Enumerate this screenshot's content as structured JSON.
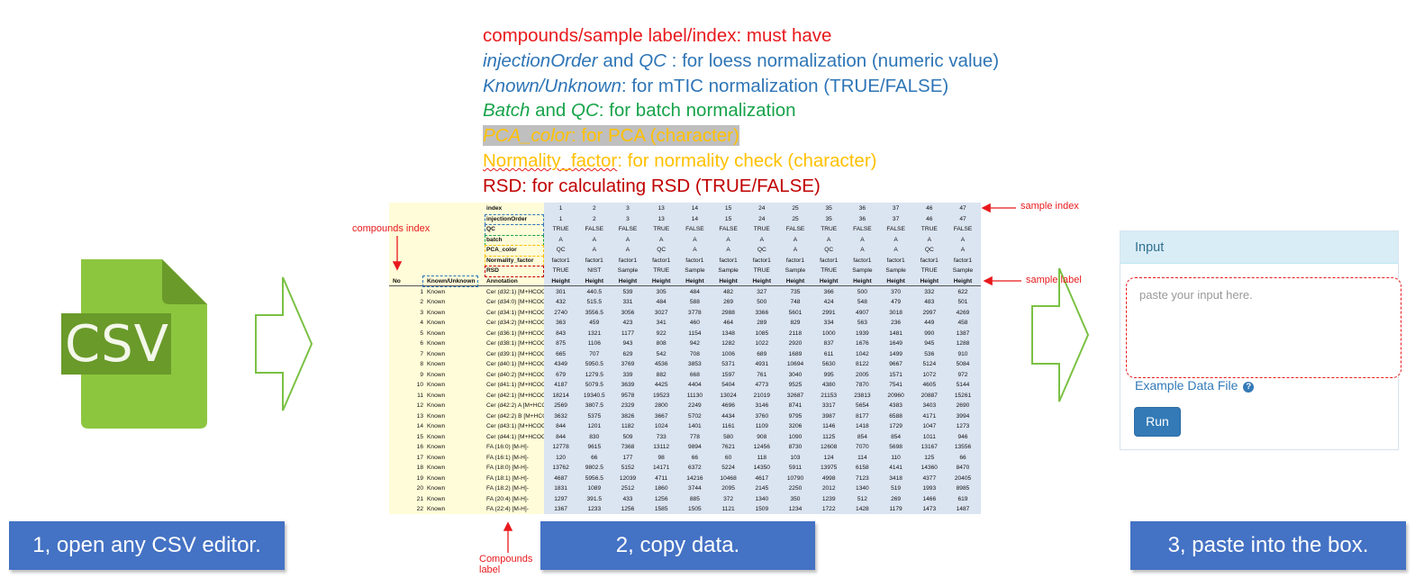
{
  "csv_icon": {
    "label": "CSV",
    "color_main": "#8cc63f",
    "color_fold": "#6a9a2a"
  },
  "legend": {
    "line1": "compounds/sample label/index: must have",
    "line2_a": "injectionOrder",
    "line2_b": " and ",
    "line2_c": "QC",
    "line2_d": " : for loess normalization (numeric value)",
    "line3_a": "Known/Unknown",
    "line3_b": ": for mTIC normalization (TRUE/FALSE)",
    "line4_a": "Batch",
    "line4_b": " and ",
    "line4_c": "QC",
    "line4_d": ": for batch normalization",
    "line5_a": "PCA_color",
    "line5_b": ": for PCA (character)",
    "line6_a": "Normality_factor",
    "line6_b": ": for normality check (character)",
    "line7": "RSD: for calculating RSD (TRUE/FALSE)"
  },
  "spreadsheet": {
    "meta_rows": [
      {
        "label": "index",
        "values": [
          "1",
          "2",
          "3",
          "13",
          "14",
          "15",
          "24",
          "25",
          "35",
          "36",
          "37",
          "46",
          "47"
        ]
      },
      {
        "label": "injectionOrder",
        "values": [
          "1",
          "2",
          "3",
          "13",
          "14",
          "15",
          "24",
          "25",
          "35",
          "36",
          "37",
          "46",
          "47"
        ]
      },
      {
        "label": "QC",
        "values": [
          "TRUE",
          "FALSE",
          "FALSE",
          "TRUE",
          "FALSE",
          "FALSE",
          "TRUE",
          "FALSE",
          "TRUE",
          "FALSE",
          "FALSE",
          "TRUE",
          "FALSE"
        ]
      },
      {
        "label": "batch",
        "values": [
          "A",
          "A",
          "A",
          "A",
          "A",
          "A",
          "A",
          "A",
          "A",
          "A",
          "A",
          "A",
          "A"
        ]
      },
      {
        "label": "PCA_color",
        "values": [
          "QC",
          "A",
          "A",
          "QC",
          "A",
          "A",
          "QC",
          "A",
          "QC",
          "A",
          "A",
          "QC",
          "A"
        ]
      },
      {
        "label": "Normality_factor",
        "values": [
          "factor1",
          "factor1",
          "factor1",
          "factor1",
          "factor1",
          "factor1",
          "factor1",
          "factor1",
          "factor1",
          "factor1",
          "factor1",
          "factor1",
          "factor1"
        ]
      },
      {
        "label": "RSD",
        "values": [
          "TRUE",
          "NIST",
          "Sample",
          "TRUE",
          "Sample",
          "Sample",
          "TRUE",
          "Sample",
          "TRUE",
          "Sample",
          "Sample",
          "TRUE",
          "Sample"
        ]
      }
    ],
    "header": {
      "no": "No",
      "known": "Known/Unknown",
      "annotation": "Annotation",
      "value_header": "Height"
    },
    "rows": [
      {
        "no": "1",
        "known": "Known",
        "annotation": "Cer (d32:1) [M+HCOO",
        "values": [
          "301",
          "440.5",
          "539",
          "305",
          "484",
          "482",
          "327",
          "735",
          "366",
          "500",
          "370",
          "332",
          "622"
        ]
      },
      {
        "no": "2",
        "known": "Known",
        "annotation": "Cer (d34:0) [M+HCOO",
        "values": [
          "432",
          "515.5",
          "331",
          "484",
          "588",
          "269",
          "500",
          "748",
          "424",
          "548",
          "479",
          "483",
          "501"
        ]
      },
      {
        "no": "3",
        "known": "Known",
        "annotation": "Cer (d34:1) [M+HCOO",
        "values": [
          "2740",
          "3556.5",
          "3056",
          "3027",
          "3778",
          "2988",
          "3366",
          "5601",
          "2991",
          "4907",
          "3018",
          "2997",
          "4269"
        ]
      },
      {
        "no": "4",
        "known": "Known",
        "annotation": "Cer (d34:2) [M+HCOO",
        "values": [
          "363",
          "459",
          "423",
          "341",
          "460",
          "464",
          "289",
          "829",
          "334",
          "563",
          "236",
          "449",
          "458"
        ]
      },
      {
        "no": "5",
        "known": "Known",
        "annotation": "Cer (d36:1) [M+HCOO",
        "values": [
          "843",
          "1321",
          "1177",
          "922",
          "1154",
          "1348",
          "1085",
          "2118",
          "1000",
          "1939",
          "1481",
          "990",
          "1387"
        ]
      },
      {
        "no": "6",
        "known": "Known",
        "annotation": "Cer (d38:1) [M+HCOO",
        "values": [
          "875",
          "1106",
          "943",
          "808",
          "942",
          "1282",
          "1022",
          "2920",
          "837",
          "1676",
          "1649",
          "945",
          "1288"
        ]
      },
      {
        "no": "7",
        "known": "Known",
        "annotation": "Cer (d39:1) [M+HCOO",
        "values": [
          "665",
          "707",
          "629",
          "542",
          "708",
          "1006",
          "689",
          "1689",
          "611",
          "1042",
          "1499",
          "536",
          "910"
        ]
      },
      {
        "no": "8",
        "known": "Known",
        "annotation": "Cer (d40:1) [M+HCOO",
        "values": [
          "4349",
          "5950.5",
          "3769",
          "4536",
          "3853",
          "5371",
          "4931",
          "10694",
          "5630",
          "8122",
          "9667",
          "5124",
          "5084"
        ]
      },
      {
        "no": "9",
        "known": "Known",
        "annotation": "Cer (d40:2) [M+HCOO",
        "values": [
          "679",
          "1279.5",
          "339",
          "882",
          "668",
          "1597",
          "761",
          "3040",
          "995",
          "2005",
          "1571",
          "1072",
          "972"
        ]
      },
      {
        "no": "10",
        "known": "Known",
        "annotation": "Cer (d41:1) [M+HCOO",
        "values": [
          "4187",
          "5079.5",
          "3639",
          "4425",
          "4404",
          "5404",
          "4773",
          "9525",
          "4380",
          "7870",
          "7541",
          "4605",
          "5144"
        ]
      },
      {
        "no": "11",
        "known": "Known",
        "annotation": "Cer (d42:1) [M+HCOO",
        "values": [
          "18214",
          "19340.5",
          "9578",
          "19523",
          "11130",
          "13024",
          "21019",
          "32687",
          "21153",
          "23813",
          "20960",
          "20887",
          "15261"
        ]
      },
      {
        "no": "12",
        "known": "Known",
        "annotation": "Cer (d42:2) A [M+HCO",
        "values": [
          "2569",
          "3807.5",
          "2329",
          "2800",
          "2249",
          "4696",
          "3146",
          "8741",
          "3317",
          "5654",
          "4383",
          "3403",
          "2690"
        ]
      },
      {
        "no": "13",
        "known": "Known",
        "annotation": "Cer (d42:2) B [M+HCO",
        "values": [
          "3632",
          "5375",
          "3826",
          "3667",
          "5702",
          "4434",
          "3760",
          "9795",
          "3987",
          "8177",
          "6588",
          "4171",
          "3994"
        ]
      },
      {
        "no": "14",
        "known": "Known",
        "annotation": "Cer (d43:1) [M+HCOO",
        "values": [
          "844",
          "1201",
          "1182",
          "1024",
          "1401",
          "1161",
          "1109",
          "3206",
          "1146",
          "1418",
          "1729",
          "1047",
          "1273"
        ]
      },
      {
        "no": "15",
        "known": "Known",
        "annotation": "Cer (d44:1) [M+HCOO",
        "values": [
          "844",
          "830",
          "509",
          "733",
          "778",
          "580",
          "908",
          "1090",
          "1125",
          "854",
          "854",
          "1011",
          "946"
        ]
      },
      {
        "no": "16",
        "known": "Known",
        "annotation": "FA (16:0) [M-H]-",
        "values": [
          "12778",
          "9615",
          "7368",
          "13112",
          "9894",
          "7621",
          "12456",
          "8730",
          "12608",
          "7070",
          "5698",
          "13167",
          "13556"
        ]
      },
      {
        "no": "17",
        "known": "Known",
        "annotation": "FA (16:1) [M-H]-",
        "values": [
          "120",
          "66",
          "177",
          "98",
          "66",
          "60",
          "118",
          "103",
          "124",
          "114",
          "110",
          "125",
          "66"
        ]
      },
      {
        "no": "18",
        "known": "Known",
        "annotation": "FA (18:0) [M-H]-",
        "values": [
          "13762",
          "9802.5",
          "5152",
          "14171",
          "6372",
          "5224",
          "14350",
          "5911",
          "13975",
          "6158",
          "4141",
          "14360",
          "8470"
        ]
      },
      {
        "no": "19",
        "known": "Known",
        "annotation": "FA (18:1) [M-H]-",
        "values": [
          "4687",
          "5956.5",
          "12039",
          "4711",
          "14216",
          "10468",
          "4617",
          "10790",
          "4998",
          "7123",
          "3418",
          "4377",
          "20405"
        ]
      },
      {
        "no": "20",
        "known": "Known",
        "annotation": "FA (18:2) [M-H]-",
        "values": [
          "1831",
          "1089",
          "2512",
          "1860",
          "3744",
          "2095",
          "2145",
          "2250",
          "2012",
          "1340",
          "519",
          "1993",
          "8985"
        ]
      },
      {
        "no": "21",
        "known": "Known",
        "annotation": "FA (20:4) [M-H]-",
        "values": [
          "1297",
          "391.5",
          "433",
          "1256",
          "885",
          "372",
          "1340",
          "350",
          "1239",
          "512",
          "269",
          "1466",
          "619"
        ]
      },
      {
        "no": "22",
        "known": "Known",
        "annotation": "FA (22:4) [M-H]-",
        "values": [
          "1367",
          "1233",
          "1256",
          "1585",
          "1505",
          "1121",
          "1509",
          "1234",
          "1722",
          "1428",
          "1179",
          "1473",
          "1487"
        ]
      }
    ]
  },
  "annotations": {
    "sample_index": "sample index",
    "compounds_index": "compounds index",
    "sample_label": "sample label",
    "compounds_label_1": "Compounds",
    "compounds_label_2": "label"
  },
  "input_panel": {
    "title": "Input",
    "placeholder": "paste your input here.",
    "example_link": "Example Data File",
    "help_glyph": "?",
    "run_label": "Run"
  },
  "steps": {
    "step1": "1, open any CSV editor.",
    "step2": "2, copy data.",
    "step3": "3, paste into the box."
  },
  "colors": {
    "step_bg": "#4472c4",
    "arrow_green": "#7ac143",
    "annotation_red": "#e8191c",
    "panel_header": "#d9edf7",
    "run_button": "#337ab7"
  }
}
